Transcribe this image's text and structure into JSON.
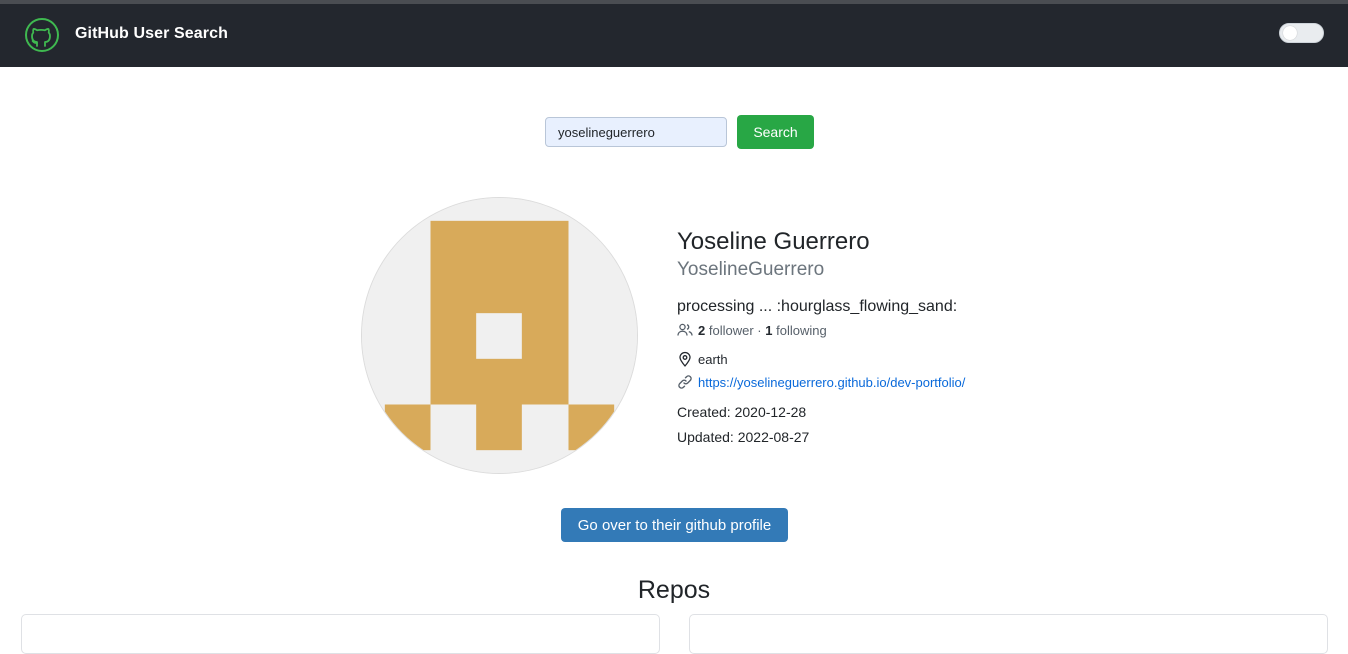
{
  "navbar": {
    "title": "GitHub User Search",
    "logo_icon": "github-octocat-icon",
    "logo_color": "#3fb950",
    "background": "#23272e",
    "theme_toggle": {
      "state": "off"
    }
  },
  "search": {
    "value": "yoselineguerrero",
    "button_label": "Search",
    "button_color": "#28a745"
  },
  "profile": {
    "avatar": {
      "colors": {
        "fill": "#d8aa5a",
        "background": "#f0f0f0"
      }
    },
    "name": "Yoseline Guerrero",
    "login": "YoselineGuerrero",
    "bio": "processing ... :hourglass_flowing_sand:",
    "followers_count": "2",
    "followers_label": "follower",
    "separator": "·",
    "following_count": "1",
    "following_label": "following",
    "location": "earth",
    "blog": "https://yoselineguerrero.github.io/dev-portfolio/",
    "created": "Created: 2020-12-28",
    "updated": "Updated: 2022-08-27",
    "icons": {
      "followers": "people-icon",
      "location": "location-pin-icon",
      "blog": "link-icon"
    }
  },
  "actions": {
    "profile_button_label": "Go over to their github profile",
    "profile_button_color": "#337ab7"
  },
  "repos": {
    "heading": "Repos"
  }
}
